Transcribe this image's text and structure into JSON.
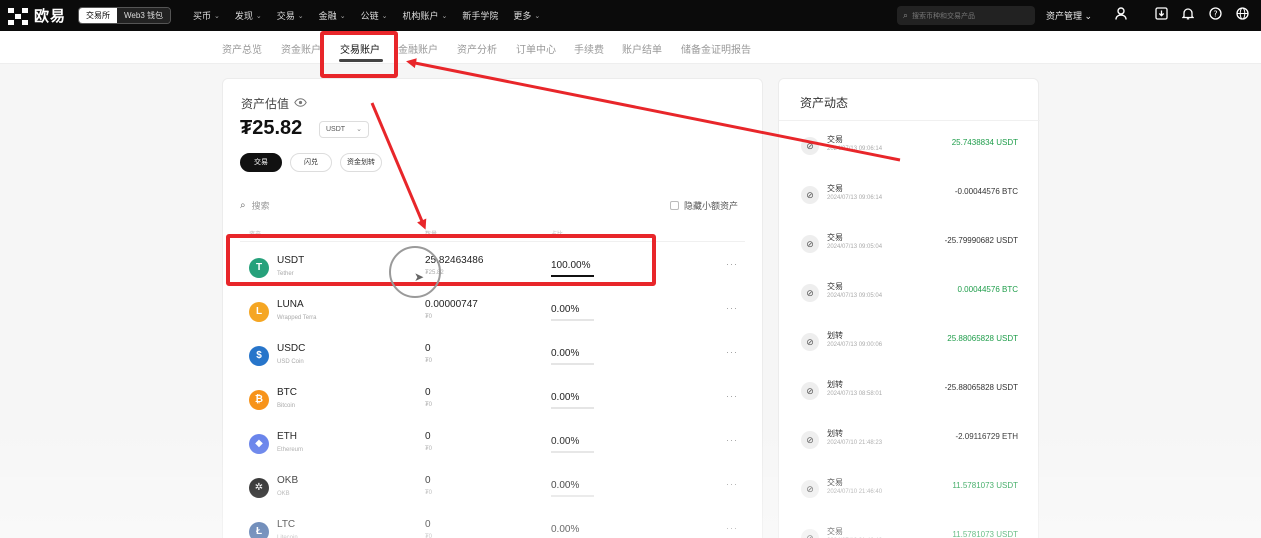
{
  "topbar": {
    "logo_text": "欧易",
    "mode_exchange": "交易所",
    "mode_web3": "Web3 钱包",
    "nav": [
      "买币",
      "发现",
      "交易",
      "金融",
      "公链",
      "机构账户",
      "新手学院",
      "更多"
    ],
    "nav_has_chevron": [
      true,
      true,
      true,
      true,
      true,
      true,
      false,
      true
    ],
    "search_placeholder": "搜索币种和交易产品",
    "asset_menu": "资产管理"
  },
  "subnav": {
    "items": [
      "资产总览",
      "资金账户",
      "交易账户",
      "金融账户",
      "资产分析",
      "订单中心",
      "手续费",
      "账户结单",
      "储备金证明报告"
    ],
    "active_index": 2
  },
  "overview": {
    "label": "资产估值",
    "value": "₮25.82",
    "currency": "USDT",
    "actions": [
      "交易",
      "闪兑",
      "资金划转"
    ]
  },
  "asset_list": {
    "search_placeholder": "搜索",
    "hide_small_label": "隐藏小额资产",
    "columns": [
      "资产",
      "数量",
      "占比"
    ],
    "rows": [
      {
        "symbol": "USDT",
        "name": "Tether",
        "amount": "25.82463486",
        "value": "₮25.82",
        "ratio": "100.00%",
        "ratio_fraction": 1.0,
        "icon": "tether-icon",
        "color": "#26a17b",
        "glyph": "T"
      },
      {
        "symbol": "LUNA",
        "name": "Wrapped Terra",
        "amount": "0.00000747",
        "value": "₮0",
        "ratio": "0.00%",
        "ratio_fraction": 0.0,
        "icon": "luna-icon",
        "color": "#f5a623",
        "glyph": "L"
      },
      {
        "symbol": "USDC",
        "name": "USD Coin",
        "amount": "0",
        "value": "₮0",
        "ratio": "0.00%",
        "ratio_fraction": 0.0,
        "icon": "usdc-icon",
        "color": "#2775ca",
        "glyph": "$"
      },
      {
        "symbol": "BTC",
        "name": "Bitcoin",
        "amount": "0",
        "value": "₮0",
        "ratio": "0.00%",
        "ratio_fraction": 0.0,
        "icon": "bitcoin-icon",
        "color": "#f7931a",
        "glyph": "₿"
      },
      {
        "symbol": "ETH",
        "name": "Ethereum",
        "amount": "0",
        "value": "₮0",
        "ratio": "0.00%",
        "ratio_fraction": 0.0,
        "icon": "ethereum-icon",
        "color": "#627eea",
        "glyph": "◆"
      },
      {
        "symbol": "OKB",
        "name": "OKB",
        "amount": "0",
        "value": "₮0",
        "ratio": "0.00%",
        "ratio_fraction": 0.0,
        "icon": "okb-icon",
        "color": "#111111",
        "glyph": "✲"
      },
      {
        "symbol": "LTC",
        "name": "Litecoin",
        "amount": "0",
        "value": "₮0",
        "ratio": "0.00%",
        "ratio_fraction": 0.0,
        "icon": "litecoin-icon",
        "color": "#345d9d",
        "glyph": "Ł"
      }
    ],
    "more_glyph": "···"
  },
  "activity": {
    "title": "资产动态",
    "items": [
      {
        "type": "交易",
        "time": "2024/07/13 09:06:14",
        "amount": "25.7438834 USDT",
        "positive": true
      },
      {
        "type": "交易",
        "time": "2024/07/13 09:06:14",
        "amount": "-0.00044576 BTC",
        "positive": false
      },
      {
        "type": "交易",
        "time": "2024/07/13 09:05:04",
        "amount": "-25.79990682 USDT",
        "positive": false
      },
      {
        "type": "交易",
        "time": "2024/07/13 09:05:04",
        "amount": "0.00044576 BTC",
        "positive": true
      },
      {
        "type": "划转",
        "time": "2024/07/13 09:00:06",
        "amount": "25.88065828 USDT",
        "positive": true
      },
      {
        "type": "划转",
        "time": "2024/07/13 08:58:01",
        "amount": "-25.88065828 USDT",
        "positive": false
      },
      {
        "type": "划转",
        "time": "2024/07/10 21:48:23",
        "amount": "-2.09116729 ETH",
        "positive": false
      },
      {
        "type": "交易",
        "time": "2024/07/10 21:46:40",
        "amount": "11.5781073 USDT",
        "positive": true
      },
      {
        "type": "交易",
        "time": "2024/07/10 21:46:40",
        "amount": "11.5781073 USDT",
        "positive": true
      }
    ]
  },
  "colors": {
    "annotation": "#e8262a",
    "positive": "#1e9d4a",
    "topbar": "#0b0b0b"
  }
}
